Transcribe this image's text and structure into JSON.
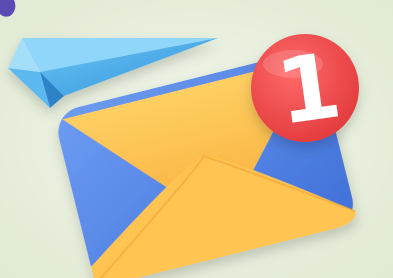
{
  "scene": {
    "description_icon": "mail-notification-illustration",
    "notification": {
      "count": "1"
    },
    "colors": {
      "background": "#e8f0de",
      "envelope_yellow": "#ffc24f",
      "envelope_yellow_dark": "#f4a93a",
      "envelope_blue": "#5a86e8",
      "badge_red": "#f0464a",
      "plane_blue": "#45a9e8"
    }
  }
}
